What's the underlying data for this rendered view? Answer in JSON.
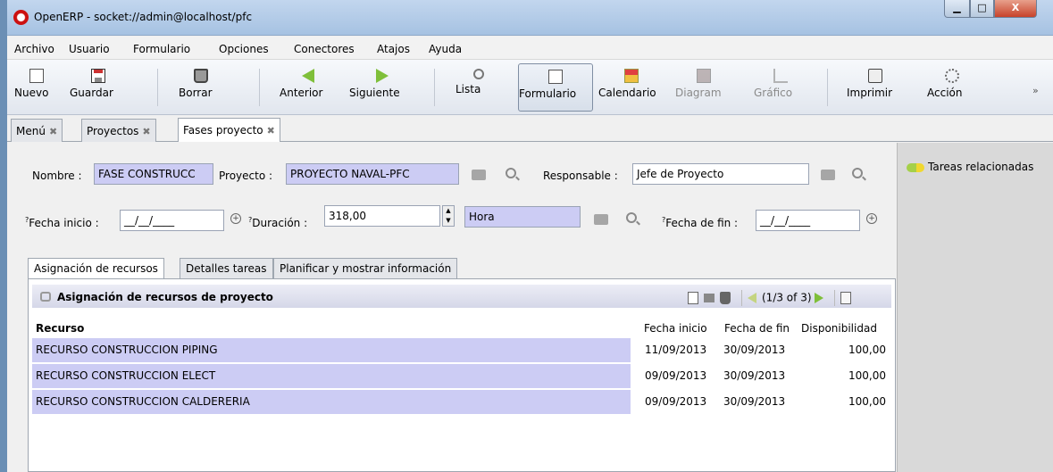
{
  "window": {
    "title": "OpenERP - socket://admin@localhost/pfc",
    "min": "▁",
    "max": "□",
    "close": "X"
  },
  "menu": [
    "Archivo",
    "Usuario",
    "Formulario",
    "Opciones",
    "Conectores",
    "Atajos",
    "Ayuda"
  ],
  "toolbar": {
    "nuevo": "Nuevo",
    "guardar": "Guardar",
    "borrar": "Borrar",
    "anterior": "Anterior",
    "siguiente": "Siguiente",
    "lista": "Lista",
    "formulario": "Formulario",
    "calendario": "Calendario",
    "diagram": "Diagram",
    "grafico": "Gráfico",
    "imprimir": "Imprimir",
    "accion": "Acción",
    "more": "»"
  },
  "tabs": {
    "menu": "Menú",
    "proyectos": "Proyectos",
    "fases": "Fases proyecto",
    "close_glyph": "✖"
  },
  "form": {
    "nombre_label": "Nombre :",
    "nombre_value": "FASE CONSTRUCC",
    "proyecto_label": "Proyecto :",
    "proyecto_value": "PROYECTO NAVAL-PFC",
    "responsable_label": "Responsable :",
    "responsable_value": "Jefe de Proyecto",
    "help_mark": "?",
    "fecha_inicio_label": "Fecha inicio :",
    "fecha_inicio_value": "__/__/____",
    "duracion_label": "Duración :",
    "duracion_value": "318,00",
    "unidad_value": "Hora",
    "fecha_fin_label": "Fecha de fin :",
    "fecha_fin_value": "__/__/____",
    "spin_up": "▲",
    "spin_down": "▼",
    "zoom_glyph": "+"
  },
  "subtabs": {
    "recursos": "Asignación de recursos",
    "detalles": "Detalles tareas",
    "planificar": "Planificar y mostrar información"
  },
  "grid": {
    "title": "Asignación de recursos de proyecto",
    "pager": "(1/3 of 3)",
    "columns": {
      "recurso": "Recurso",
      "fecha_inicio": "Fecha inicio",
      "fecha_fin": "Fecha de fin",
      "disponibilidad": "Disponibilidad"
    },
    "rows": [
      {
        "recurso": "RECURSO CONSTRUCCION  PIPING",
        "inicio": "11/09/2013",
        "fin": "30/09/2013",
        "disp": "100,00"
      },
      {
        "recurso": "RECURSO CONSTRUCCION ELECT",
        "inicio": "09/09/2013",
        "fin": "30/09/2013",
        "disp": "100,00"
      },
      {
        "recurso": "RECURSO CONSTRUCCION CALDERERIA",
        "inicio": "09/09/2013",
        "fin": "30/09/2013",
        "disp": "100,00"
      }
    ]
  },
  "sidebar": {
    "link": "Tareas relacionadas"
  }
}
